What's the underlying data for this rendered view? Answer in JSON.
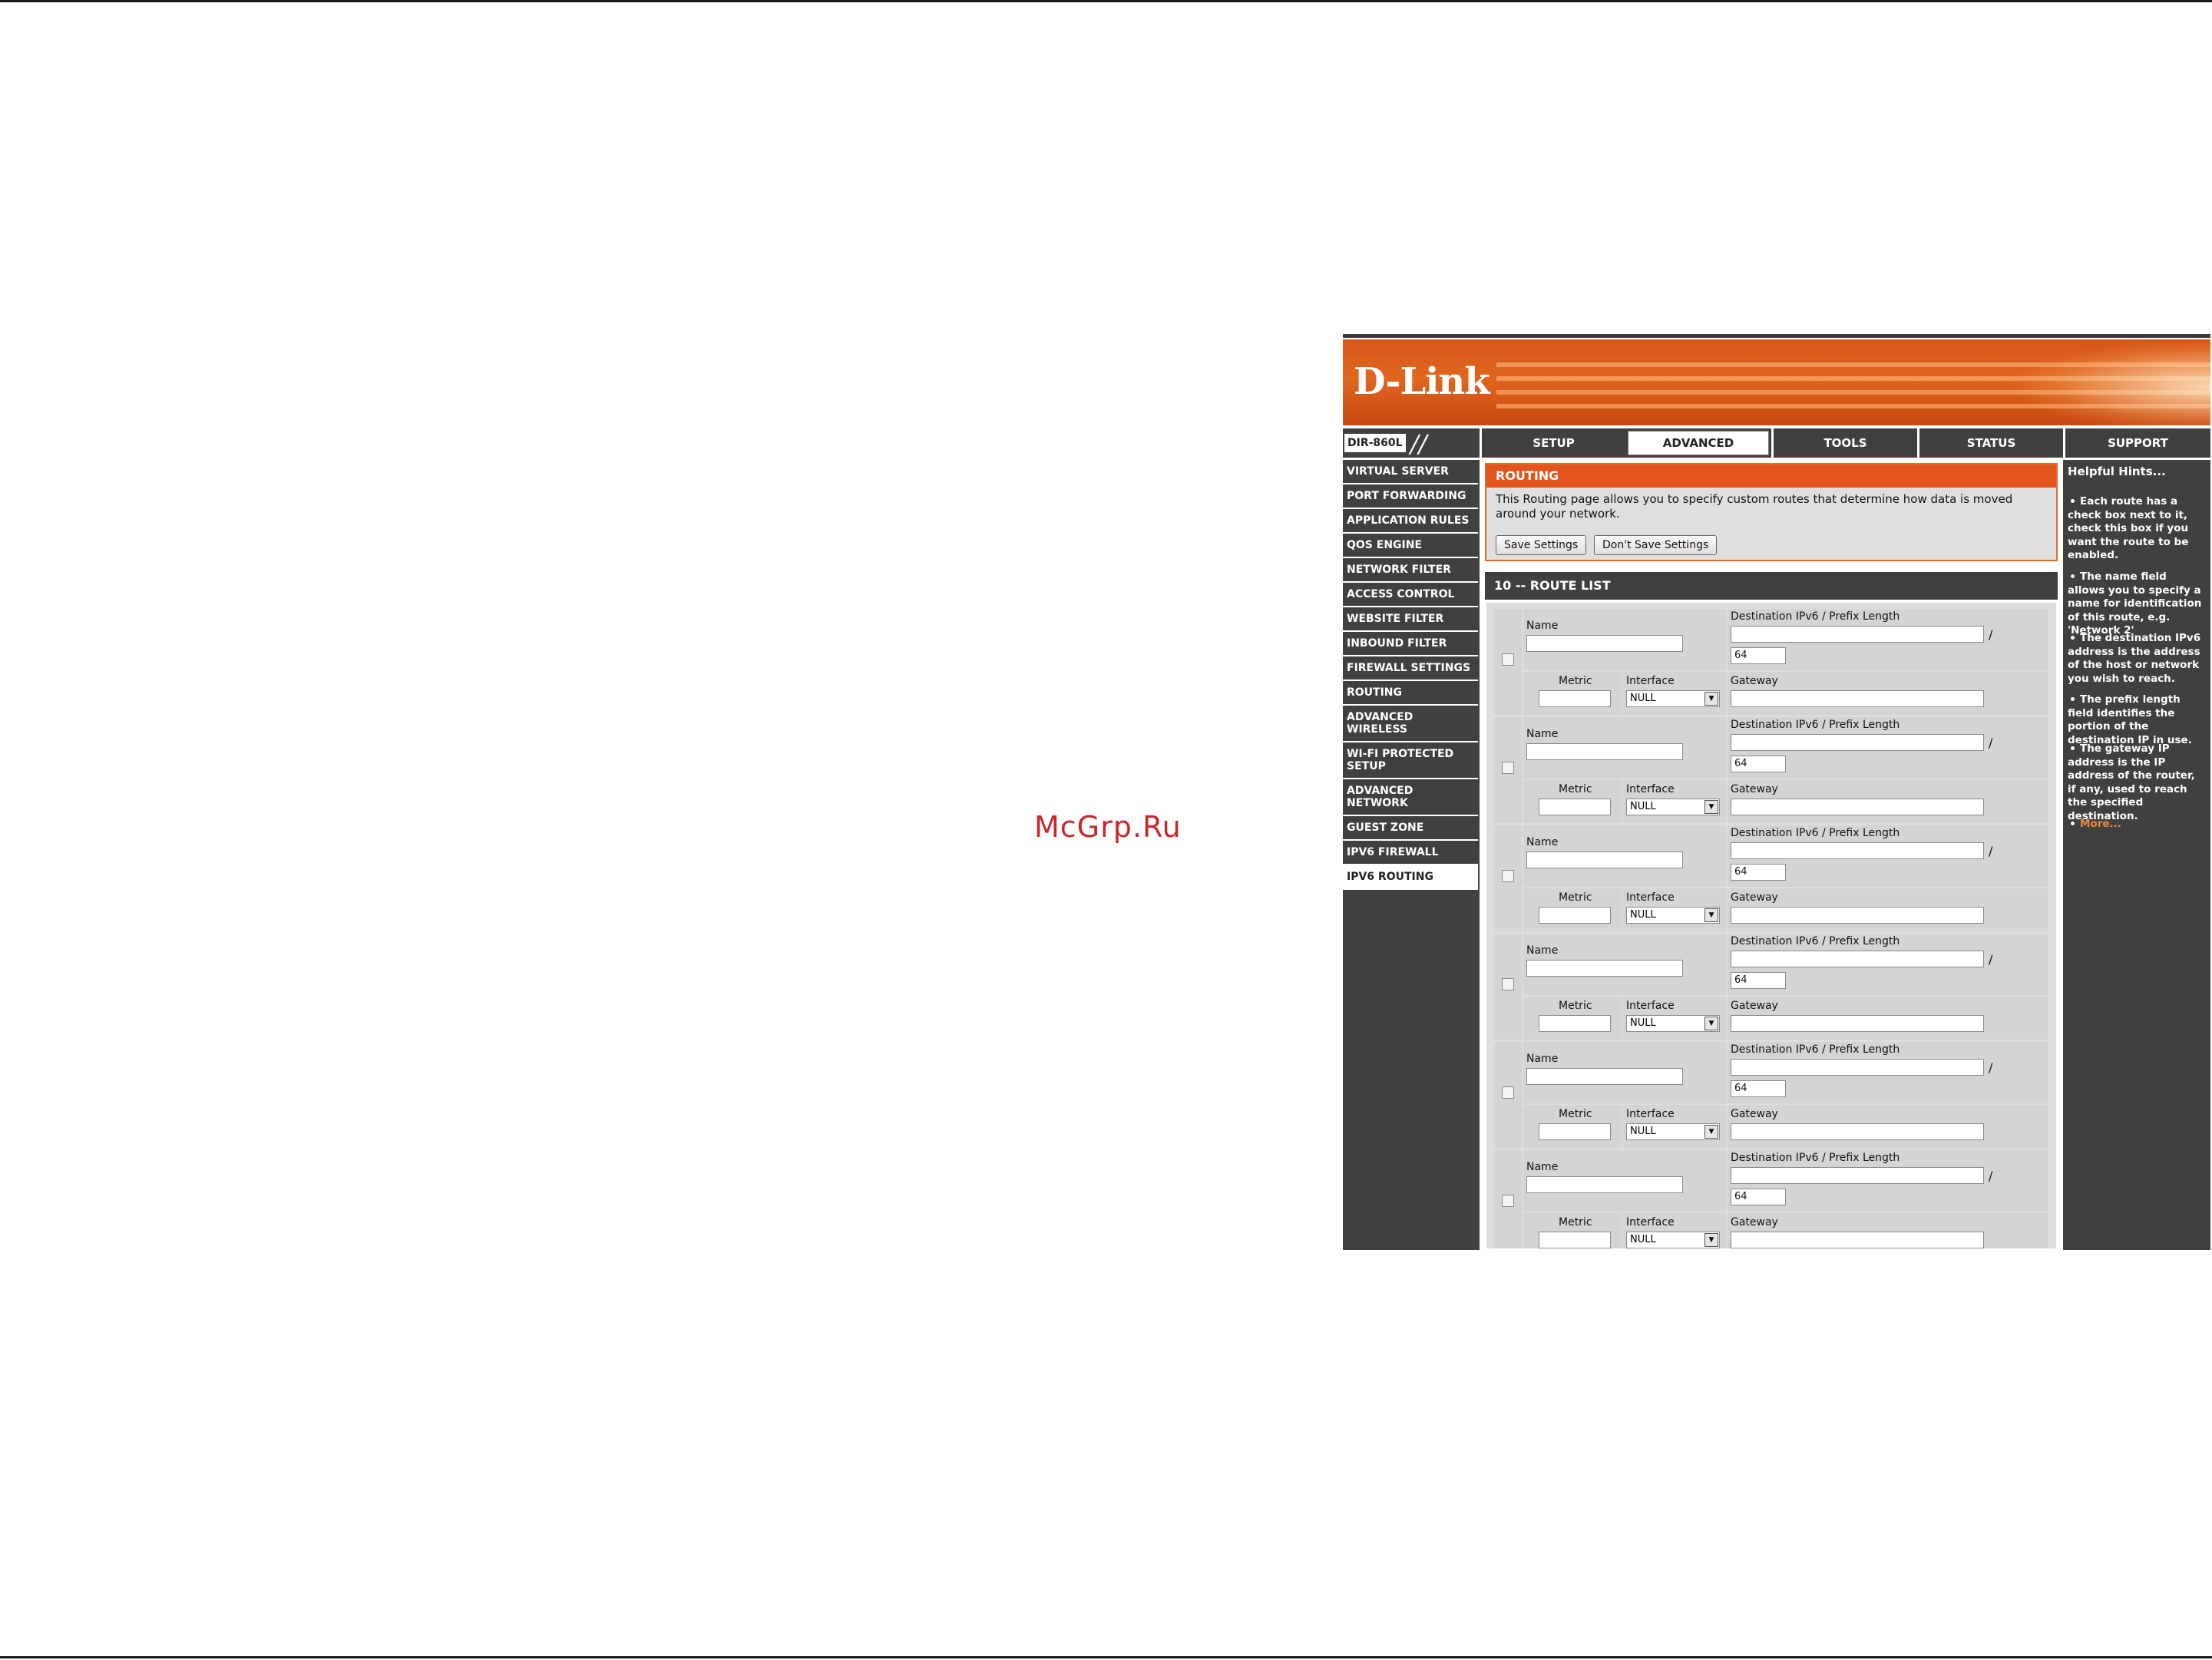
{
  "watermark": "McGrp.Ru",
  "brand": {
    "logo": "D-Link",
    "model": "DIR-860L"
  },
  "tabs": [
    {
      "label": "SETUP"
    },
    {
      "label": "ADVANCED"
    },
    {
      "label": "TOOLS"
    },
    {
      "label": "STATUS"
    },
    {
      "label": "SUPPORT"
    }
  ],
  "sidebar": [
    {
      "label": "VIRTUAL SERVER"
    },
    {
      "label": "PORT FORWARDING"
    },
    {
      "label": "APPLICATION RULES"
    },
    {
      "label": "QOS ENGINE"
    },
    {
      "label": "NETWORK FILTER"
    },
    {
      "label": "ACCESS CONTROL"
    },
    {
      "label": "WEBSITE FILTER"
    },
    {
      "label": "INBOUND FILTER"
    },
    {
      "label": "FIREWALL SETTINGS"
    },
    {
      "label": "ROUTING"
    },
    {
      "label": "ADVANCED WIRELESS"
    },
    {
      "label": "WI-FI PROTECTED SETUP"
    },
    {
      "label": "ADVANCED NETWORK"
    },
    {
      "label": "GUEST ZONE"
    },
    {
      "label": "IPV6 FIREWALL"
    },
    {
      "label": "IPV6 ROUTING"
    }
  ],
  "routing": {
    "title": "ROUTING",
    "description": "This Routing page allows you to specify custom routes that determine how data is moved around your network.",
    "save_label": "Save Settings",
    "dont_save_label": "Don't Save Settings"
  },
  "route_list": {
    "title": "10 -- ROUTE LIST",
    "labels": {
      "name": "Name",
      "destination": "Destination IPv6 / Prefix Length",
      "metric": "Metric",
      "interface": "Interface",
      "gateway": "Gateway",
      "slash": "/"
    },
    "routes": [
      {
        "name": "",
        "destination": "",
        "prefix": "64",
        "metric": "",
        "interface": "NULL",
        "gateway": ""
      },
      {
        "name": "",
        "destination": "",
        "prefix": "64",
        "metric": "",
        "interface": "NULL",
        "gateway": ""
      },
      {
        "name": "",
        "destination": "",
        "prefix": "64",
        "metric": "",
        "interface": "NULL",
        "gateway": ""
      },
      {
        "name": "",
        "destination": "",
        "prefix": "64",
        "metric": "",
        "interface": "NULL",
        "gateway": ""
      },
      {
        "name": "",
        "destination": "",
        "prefix": "64",
        "metric": "",
        "interface": "NULL",
        "gateway": ""
      },
      {
        "name": "",
        "destination": "",
        "prefix": "64",
        "metric": "",
        "interface": "NULL",
        "gateway": ""
      }
    ]
  },
  "hints": {
    "title": "Helpful Hints...",
    "items": [
      "Each route has a check box next to it, check this box if you want the route to be enabled.",
      "The name field allows you to specify a name for identification of this route, e.g. 'Network 2'",
      "The destination IPv6 address is the address of the host or network you wish to reach.",
      "The prefix length field identifies the portion of the destination IP in use.",
      "The gateway IP address is the IP address of the router, if any, used to reach the specified destination."
    ],
    "more": "More..."
  },
  "colors": {
    "accent_orange": "#e2541c",
    "nav_dark": "#404040",
    "list_bg": "#dddddd",
    "watermark_red": "#c8282d"
  }
}
